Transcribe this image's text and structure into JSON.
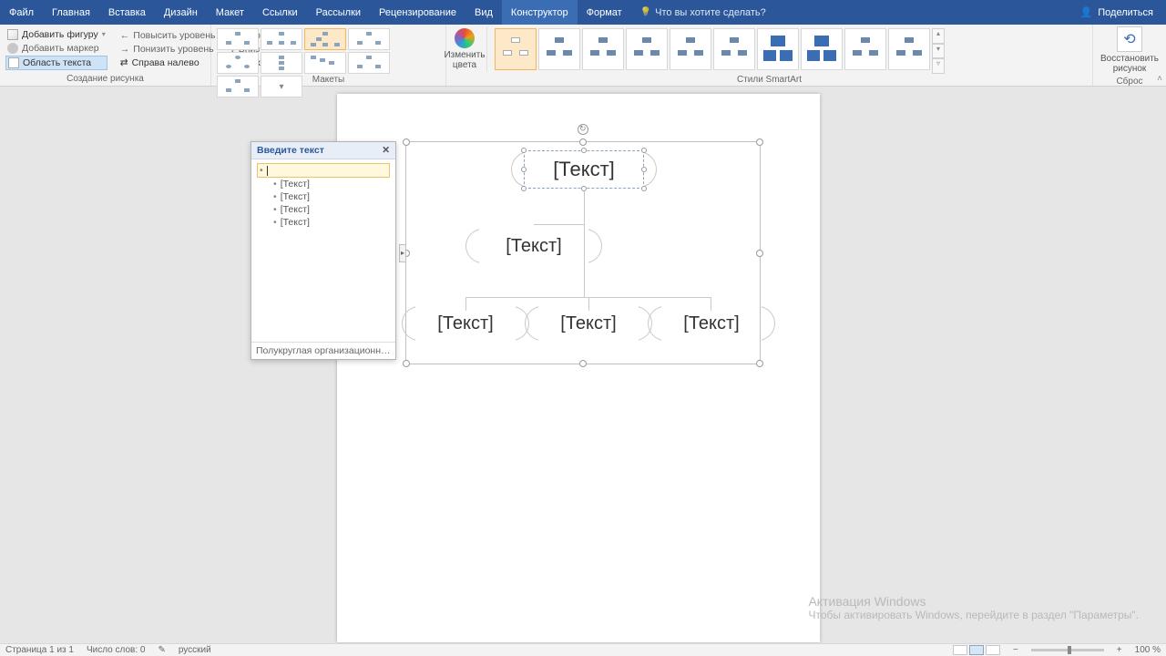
{
  "tabs": {
    "file": "Файл",
    "home": "Главная",
    "insert": "Вставка",
    "design": "Дизайн",
    "layout": "Макет",
    "references": "Ссылки",
    "mailings": "Рассылки",
    "review": "Рецензирование",
    "view": "Вид",
    "constructor": "Конструктор",
    "format": "Формат",
    "tellme": "Что вы хотите сделать?",
    "share": "Поделиться"
  },
  "create_graphic": {
    "add_shape": "Добавить фигуру",
    "add_bullet": "Добавить маркер",
    "text_pane": "Область текста",
    "promote": "Повысить уровень",
    "demote": "Понизить уровень",
    "rtl": "Справа налево",
    "up": "Вверх",
    "down": "Вниз",
    "layout_btn": "Макет",
    "group_label": "Создание рисунка"
  },
  "layouts": {
    "group_label": "Макеты"
  },
  "colors": {
    "btn": "Изменить цвета"
  },
  "styles": {
    "group_label": "Стили SmartArt"
  },
  "reset": {
    "btn": "Восстановить рисунок",
    "group_label": "Сброс"
  },
  "text_pane": {
    "title": "Введите текст",
    "items": [
      "[Текст]",
      "[Текст]",
      "[Текст]",
      "[Текст]"
    ],
    "footer": "Полукруглая организационная диагр..."
  },
  "smartart": {
    "placeholder": "[Текст]"
  },
  "watermark": {
    "line1": "Активация Windows",
    "line2": "Чтобы активировать Windows, перейдите в раздел \"Параметры\"."
  },
  "status": {
    "page": "Страница 1 из 1",
    "words": "Число слов: 0",
    "lang": "русский",
    "zoom": "100 %"
  }
}
